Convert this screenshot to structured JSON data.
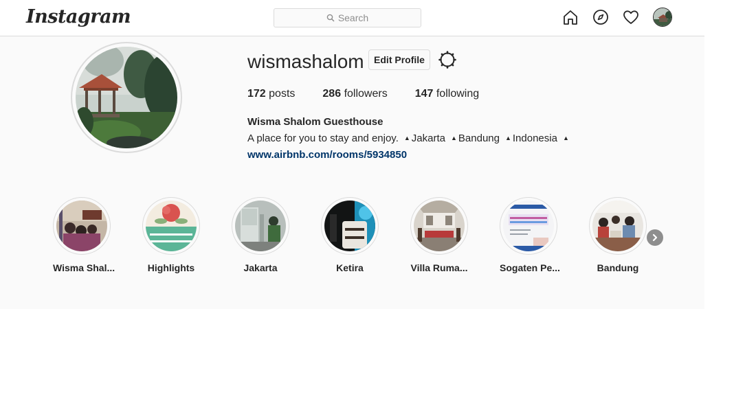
{
  "header": {
    "logo_text": "Instagram",
    "search_placeholder": "Search",
    "icons": [
      "home-icon",
      "explore-compass-icon",
      "activity-heart-icon",
      "profile-avatar-icon"
    ]
  },
  "profile": {
    "username": "wismashalom",
    "edit_button": "Edit Profile",
    "settings_icon": "gear-icon",
    "stats": {
      "posts_count": "172",
      "posts_label": "posts",
      "followers_count": "286",
      "followers_label": "followers",
      "following_count": "147",
      "following_label": "following"
    },
    "full_name": "Wisma Shalom Guesthouse",
    "bio_text": "A place for you to stay and enjoy.",
    "bio_tags": [
      "Jakarta",
      "Bandung",
      "Indonesia",
      ""
    ],
    "website": "www.airbnb.com/rooms/5934850"
  },
  "highlights": {
    "items": [
      {
        "label": "Wisma Shal..."
      },
      {
        "label": "Highlights"
      },
      {
        "label": "Jakarta"
      },
      {
        "label": "Ketira"
      },
      {
        "label": "Villa Ruma..."
      },
      {
        "label": "Sogaten Pe..."
      },
      {
        "label": "Bandung"
      }
    ],
    "next_icon": "chevron-right-icon"
  },
  "colors": {
    "link": "#003569",
    "border": "#dbdbdb",
    "panel_bg": "#fafafa",
    "text": "#262626",
    "muted": "#8e8e8e"
  }
}
